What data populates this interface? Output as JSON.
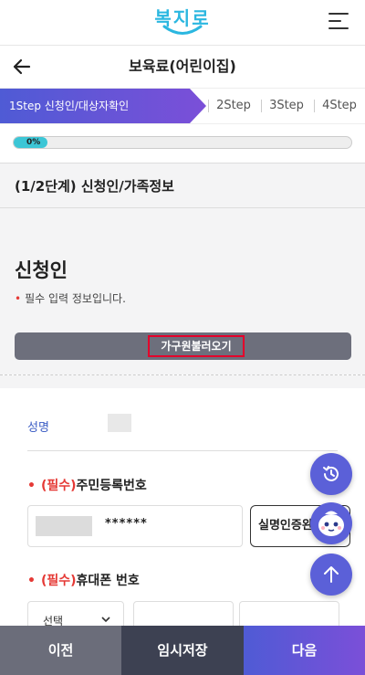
{
  "app": {
    "logo_text": "복지로"
  },
  "nav": {
    "title": "보육료(어린이집)"
  },
  "steps": [
    {
      "label": "1Step 신청인/대상자확인",
      "active": true
    },
    {
      "label": "2Step",
      "active": false
    },
    {
      "label": "3Step",
      "active": false
    },
    {
      "label": "4Step",
      "active": false
    }
  ],
  "progress": {
    "label": "0%",
    "value": 0.1
  },
  "section": {
    "title": "(1/2단계) 신청인/가족정보"
  },
  "applicant": {
    "title": "신청인",
    "required_note": "필수 입력 정보입니다.",
    "load_button": "가구원불러오기"
  },
  "form": {
    "name_label": "성명",
    "rrn": {
      "required_prefix": "(필수)",
      "label": "주민등록번호",
      "masked_value": "******",
      "verify_button": "실명인증완료"
    },
    "phone": {
      "required_prefix": "(필수)",
      "label": "휴대폰 번호",
      "select_value": "선택"
    }
  },
  "bottom": {
    "prev": "이전",
    "save": "임시저장",
    "next": "다음"
  },
  "colors": {
    "accent": "#5b60d8",
    "step_gradient_start": "#4f5bd5",
    "step_gradient_end": "#7b4fd8",
    "required": "#e53935",
    "progress_fill": "#3cc6d6"
  },
  "icons": {
    "menu": "hamburger-icon",
    "back": "arrow-left-icon",
    "history": "history-icon",
    "chatbot": "chatbot-icon",
    "scroll_top": "arrow-up-icon",
    "select": "chevron-down-icon"
  }
}
